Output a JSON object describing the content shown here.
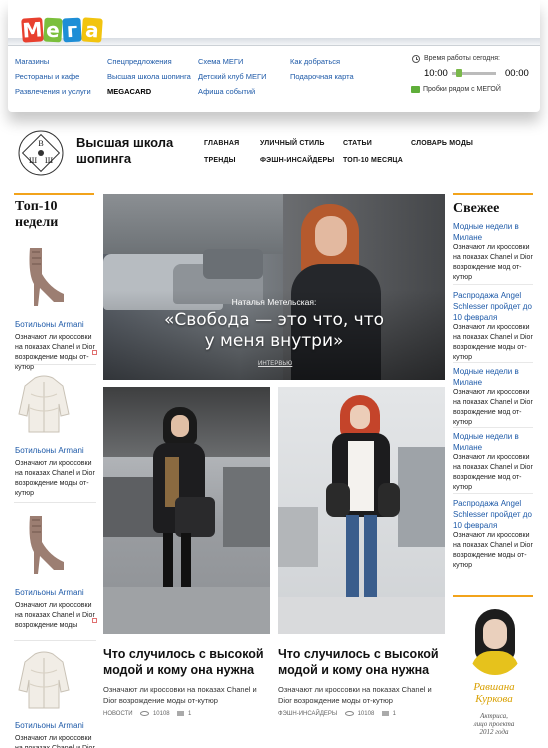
{
  "brand": {
    "letters": [
      "М",
      "е",
      "г",
      "а"
    ],
    "colors": [
      "#e8402f",
      "#7bbf3c",
      "#1e8ed6",
      "#f2c40f"
    ]
  },
  "top_nav": {
    "col1": [
      "Магазины",
      "Рестораны и кафе",
      "Развлечения и услуги"
    ],
    "col2": [
      "Спецпредложения",
      "Высшая школа шопинга",
      "MEGACARD"
    ],
    "col3": [
      "Схема МЕГИ",
      "Детский клуб МЕГИ",
      "Афиша событий"
    ],
    "col4": [
      "Как добраться",
      "Подарочная карта"
    ]
  },
  "hours": {
    "label": "Время работы сегодня:",
    "open": "10:00",
    "close": "00:00",
    "traffic": "Пробки рядом с МЕГОЙ"
  },
  "school": {
    "emblem_letters": [
      "В",
      "Ш",
      "Ш"
    ],
    "title_line1": "Высшая школа",
    "title_line2": "шопинга",
    "menu_row1": [
      "ГЛАВНАЯ",
      "УЛИЧНЫЙ СТИЛЬ",
      "СТАТЬИ",
      "СЛОВАРЬ МОДЫ"
    ],
    "menu_row2": [
      "ТРЕНДЫ",
      "ФЭШН-ИНСАЙДЕРЫ",
      "ТОП-10 МЕСЯЦА"
    ]
  },
  "top10": {
    "title_line1": "Топ-10",
    "title_line2": "недели",
    "items": [
      {
        "name": "Ботильоны Armani",
        "desc": "Означают ли кроссовки на показах Chanel и Dior возрождение моды от-кутюр"
      },
      {
        "name": "Ботильоны Armani",
        "desc": "Означают ли кроссовки на показах Chanel и Dior возрождение моды от-кутюр"
      },
      {
        "name": "Ботильоны Armani",
        "desc": "Означают ли кроссовки на показах Chanel и Dior возрождение моды"
      },
      {
        "name": "Ботильоны Armani",
        "desc": "Означают ли кроссовки на показах Chanel и Dior возрождение моды от-кутюр"
      }
    ]
  },
  "hero": {
    "name": "Наталья Метельская:",
    "quote_line1": "«Свобода — это что, что",
    "quote_line2": "у меня внутри»",
    "tag": "ИНТЕРВЬЮ"
  },
  "articles": [
    {
      "title_line1": "Что случилось с высокой",
      "title_line2": "модой и кому она нужна",
      "desc": "Означают ли кроссовки на показах Chanel и Dior возрождение моды от-кутюр",
      "category": "НОВОСТИ",
      "views": "10108",
      "comments": "1"
    },
    {
      "title_line1": "Что случилось с высокой",
      "title_line2": "модой и кому она нужна",
      "desc": "Означают ли кроссовки на показах Chanel и Dior возрождение моды от-кутюр",
      "category": "ФЭШН-ИНСАЙДЕРЫ",
      "views": "10108",
      "comments": "1"
    }
  ],
  "fresh": {
    "title": "Свежее",
    "items": [
      {
        "title": "Модные недели в Милане",
        "desc": "Означают ли кроссовки на показах Chanel и Dior возрождение мод от-кутюр"
      },
      {
        "title": "Распродажа Angel Schlesser пройдет до 10 февраля",
        "desc": "Означают ли кроссовки на показах Chanel и Dior возрождение моды от-кутюр"
      },
      {
        "title": "Модные недели в Милане",
        "desc": "Означают ли кроссовки на показах Chanel и Dior возрождение мод от-кутюр"
      },
      {
        "title": "Модные недели в Милане",
        "desc": "Означают ли кроссовки на показах Chanel и Dior возрождение мод от-кутюр"
      },
      {
        "title": "Распродажа Angel Schlesser пройдет до 10 февраля",
        "desc": "Означают ли кроссовки на показах Chanel и Dior возрождение моды от-кутюр"
      }
    ]
  },
  "celebrity": {
    "name_line1": "Равшана",
    "name_line2": "Куркова",
    "role_line1": "Актриса,",
    "role_line2": "лицо проекта",
    "role_line3": "2012 года"
  }
}
